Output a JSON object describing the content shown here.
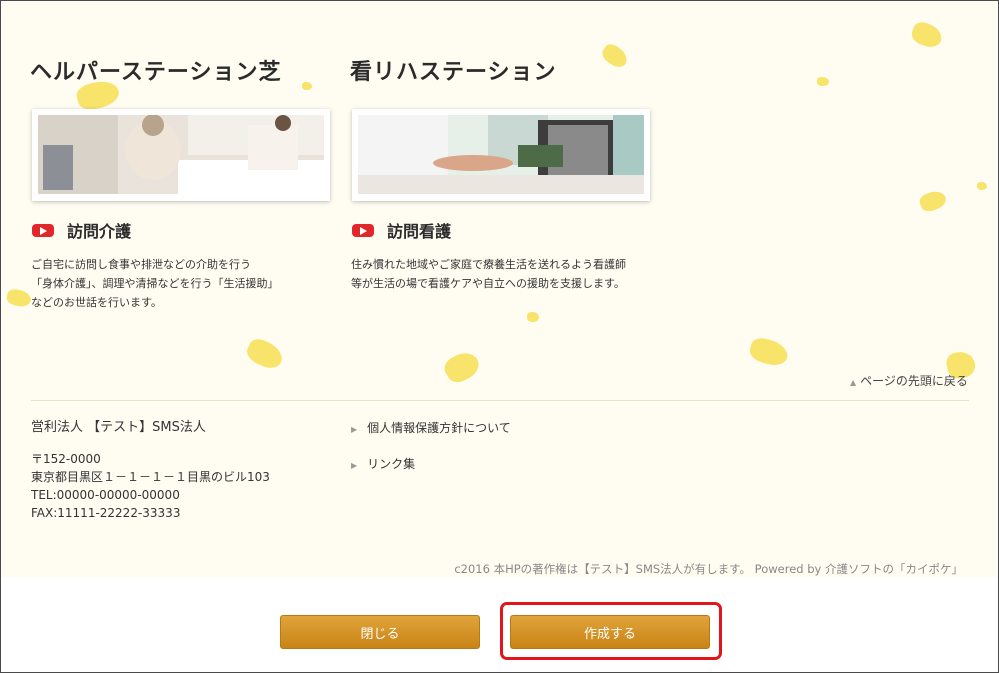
{
  "services": [
    {
      "office": "ヘルパーステーション芝",
      "label": "訪問介護",
      "description": "ご自宅に訪問し食事や排泄などの介助を行う\n「身体介護」、調理や清掃などを行う「生活援助」\nなどのお世話を行います。"
    },
    {
      "office": "看リハステーション",
      "label": "訪問看護",
      "description": "住み慣れた地域やご家庭で療養生活を送れるよう看護師\n等が生活の場で看護ケアや自立への援助を支援します。"
    }
  ],
  "page_top_link": "ページの先頭に戻る",
  "footer": {
    "organization": "営利法人 【テスト】SMS法人",
    "address_lines": [
      "〒152-0000",
      "東京都目黒区１－１－１－１目黒のビル103",
      "TEL:00000-00000-00000",
      "FAX:11111-22222-33333"
    ],
    "links": [
      "個人情報保護方針について",
      "リンク集"
    ],
    "copyright": "c2016 本HPの著作権は【テスト】SMS法人が有します。 Powered by 介護ソフトの「カイポケ」"
  },
  "buttons": {
    "close": "閉じる",
    "create": "作成する"
  },
  "colors": {
    "accent_button": "#d89523",
    "highlight": "#e4141b",
    "service_icon": "#e0282c",
    "background": "#fffdf1"
  }
}
